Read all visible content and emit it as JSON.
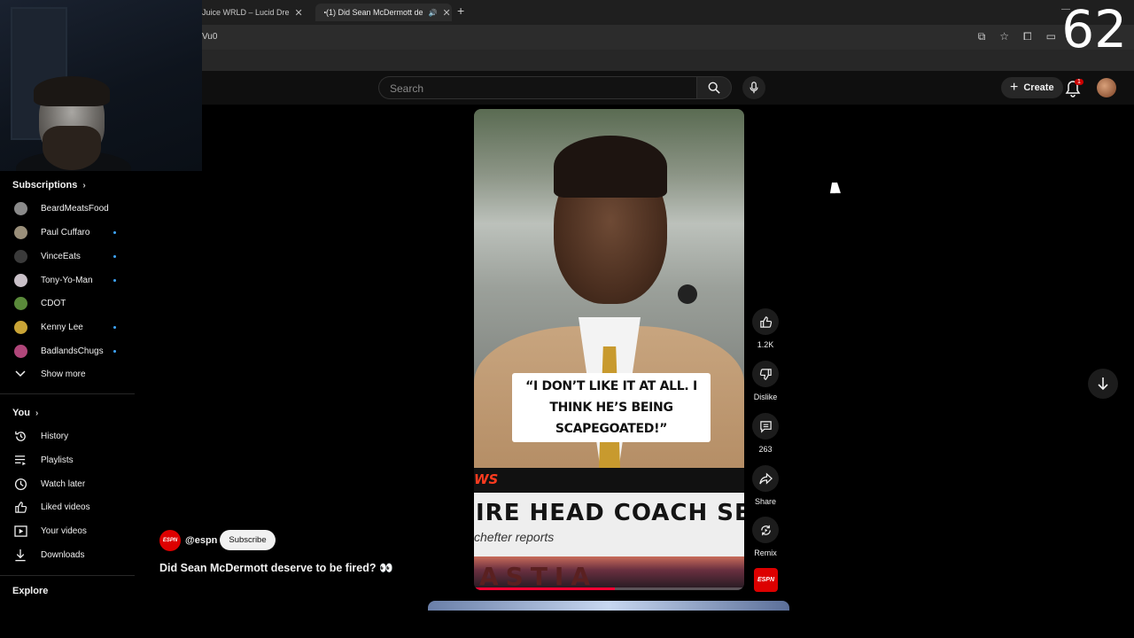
{
  "browser": {
    "tabs": [
      {
        "label": "Juice WRLD – Lucid Dre",
        "active": false
      },
      {
        "label": "(1) Did Sean McDermott de",
        "active": true
      }
    ],
    "url_visible": "Vu0",
    "counter_overlay": "62"
  },
  "header": {
    "search_placeholder": "Search",
    "create_label": "Create",
    "notification_count": "1"
  },
  "sidebar": {
    "subscriptions_title": "Subscriptions",
    "subscriptions": [
      {
        "name": "BeardMeatsFood",
        "new": false,
        "color": "#8a8a8a"
      },
      {
        "name": "Paul Cuffaro",
        "new": true,
        "color": "#9a8f7a"
      },
      {
        "name": "VinceEats",
        "new": true,
        "color": "#3a3a3a"
      },
      {
        "name": "Tony-Yo-Man",
        "new": true,
        "color": "#c9c0c8"
      },
      {
        "name": "CDOT",
        "new": false,
        "color": "#5a8a3a"
      },
      {
        "name": "Kenny Lee",
        "new": true,
        "color": "#c9a436"
      },
      {
        "name": "BadlandsChugs",
        "new": true,
        "color": "#b0467a"
      }
    ],
    "show_more": "Show more",
    "you_title": "You",
    "you_items": [
      {
        "label": "History",
        "icon": "history-icon"
      },
      {
        "label": "Playlists",
        "icon": "playlists-icon"
      },
      {
        "label": "Watch later",
        "icon": "clock-icon"
      },
      {
        "label": "Liked videos",
        "icon": "thumbs-up-icon"
      },
      {
        "label": "Your videos",
        "icon": "play-square-icon"
      },
      {
        "label": "Downloads",
        "icon": "download-icon"
      }
    ],
    "explore_title": "Explore"
  },
  "video": {
    "quote_line1": "“I DON’T LIKE IT AT ALL. I",
    "quote_line2": "THINK HE’S BEING SCAPEGOATED!”",
    "banner_fragment": "WS",
    "headline": "IRE HEAD COACH SE",
    "subheadline": "chefter reports",
    "bottom_fragment": "ASTIA",
    "progress": 0.52
  },
  "actions": {
    "likes": "1.2K",
    "dislike": "Dislike",
    "comments": "263",
    "share": "Share",
    "remix": "Remix"
  },
  "channel": {
    "logo_text": "ESPN",
    "handle": "@espn",
    "subscribe": "Subscribe",
    "title": "Did Sean McDermott deserve to be fired? 👀"
  },
  "colors": {
    "accent": "#ff0033",
    "background": "#0f0f0f",
    "new_dot": "#3ea6ff"
  }
}
